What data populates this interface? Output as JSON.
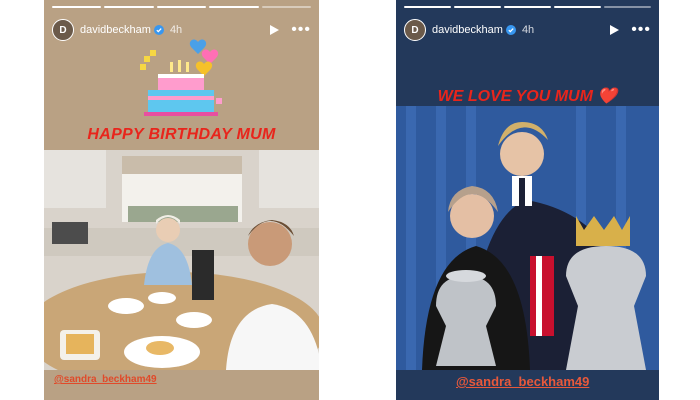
{
  "story_left": {
    "username": "davidbeckham",
    "time": "4h",
    "avatar_initial": "D",
    "caption": "HAPPY BIRTHDAY MUM",
    "mention": "@sandra_beckham49"
  },
  "story_right": {
    "username": "davidbeckham",
    "time": "4h",
    "avatar_initial": "D",
    "caption": "WE LOVE YOU MUM ❤️",
    "mention": "@sandra_beckham49"
  },
  "icons": {
    "verified": "verified-badge-icon",
    "play": "play-icon",
    "more": "more-options-icon",
    "cake": "birthday-cake-icon"
  },
  "colors": {
    "caption_red": "#e8251c",
    "left_bg": "#b9a184",
    "right_bg": "#23395b"
  }
}
